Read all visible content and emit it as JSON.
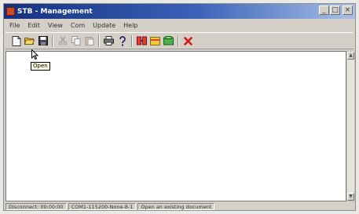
{
  "window": {
    "title": "STB - Management",
    "controls": {
      "minimize": "_",
      "maximize": "□",
      "close": "×"
    }
  },
  "menu": [
    "File",
    "Edit",
    "View",
    "Com",
    "Update",
    "Help"
  ],
  "toolbar": {
    "icons": [
      "new-document-icon",
      "open-folder-icon",
      "save-icon",
      "cut-icon",
      "copy-icon",
      "paste-icon",
      "print-icon",
      "help-icon",
      "connect-icon",
      "card-icon",
      "device-icon",
      "close-red-icon"
    ]
  },
  "tooltip": "Open",
  "statusbar": {
    "connection": "Disconnect: 00:00:00",
    "port": "COM1-115200-None-8-1",
    "message": "Open an existing document"
  },
  "colors": {
    "titlebar": "#1f3b8c",
    "content": "#ffffff",
    "chrome": "#d4d0c8"
  }
}
